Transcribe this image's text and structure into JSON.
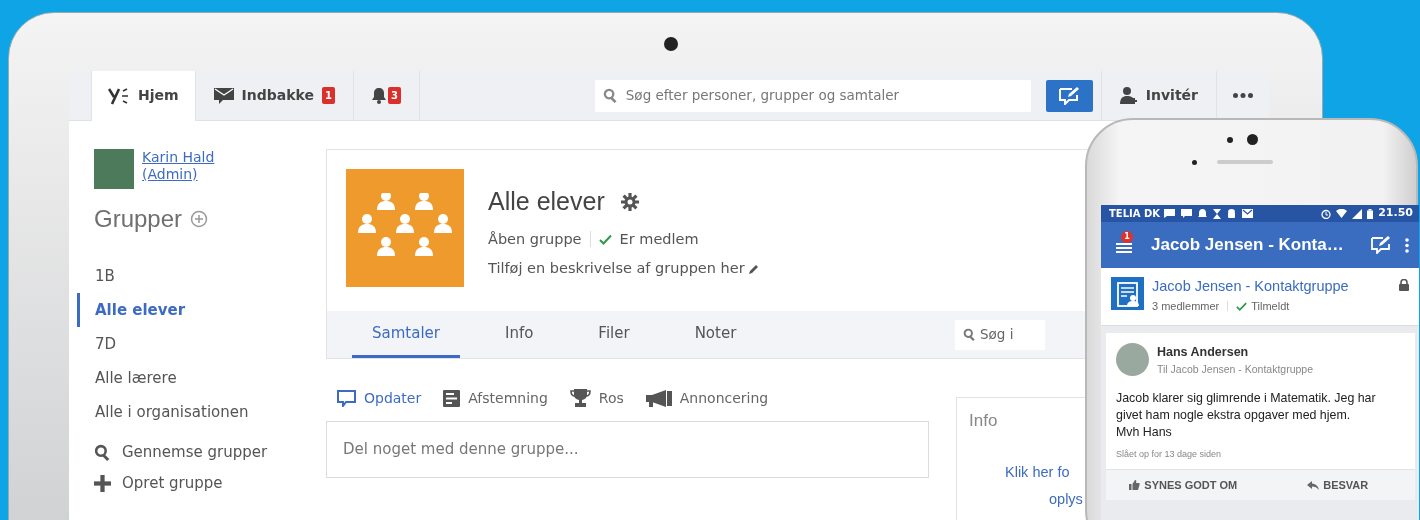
{
  "laptop": {
    "top_bar": {
      "tabs": [
        {
          "kind": "home",
          "label": "Hjem",
          "selected": true
        },
        {
          "kind": "inbox",
          "label": "Indbakke",
          "badge": "1",
          "selected": false
        },
        {
          "kind": "notifications",
          "badge": "3",
          "selected": false
        }
      ],
      "search": {
        "placeholder": "Søg efter personer, grupper og samtaler"
      },
      "invite": "Invitér"
    },
    "sidebar": {
      "user": "Karin Hald (Admin)",
      "groups_heading": "Grupper",
      "groups": [
        {
          "label": "1B",
          "selected": false
        },
        {
          "label": "Alle elever",
          "selected": true
        },
        {
          "label": "7D",
          "selected": false
        },
        {
          "label": "Alle lærere",
          "selected": false
        },
        {
          "label": "Alle i organisationen",
          "selected": false
        }
      ],
      "actions": [
        {
          "kind": "browse",
          "label": "Gennemse grupper"
        },
        {
          "kind": "create",
          "label": "Opret gruppe"
        }
      ]
    },
    "group": {
      "title": "Alle elever",
      "visibility": "Åben gruppe",
      "membership": "Er medlem",
      "description": "Tilføj en beskrivelse af gruppen her",
      "tabs": [
        {
          "label": "Samtaler",
          "selected": true
        },
        {
          "label": "Info",
          "selected": false
        },
        {
          "label": "Filer",
          "selected": false
        },
        {
          "label": "Noter",
          "selected": false
        }
      ],
      "search": {
        "placeholder": "Søg i"
      },
      "composer": {
        "types": [
          {
            "kind": "update",
            "label": "Opdater",
            "selected": true
          },
          {
            "kind": "poll",
            "label": "Afstemning",
            "selected": false
          },
          {
            "kind": "praise",
            "label": "Ros",
            "selected": false
          },
          {
            "kind": "announcement",
            "label": "Annoncering",
            "selected": false
          }
        ],
        "placeholder": "Del noget med denne gruppe..."
      },
      "info": {
        "title": "Info",
        "link_lines": [
          "Klik her fo",
          "oplys"
        ]
      }
    }
  },
  "phone": {
    "status_bar": {
      "carrier": "TELIA DK",
      "time": "21.50"
    },
    "app_bar": {
      "menu_badge": "1",
      "title": "Jacob Jensen - Konta…"
    },
    "group": {
      "name": "Jacob Jensen - Kontaktgruppe",
      "members": "3 medlemmer",
      "status": "Tilmeldt"
    },
    "post": {
      "author": "Hans Andersen",
      "target": "Til Jacob Jensen - Kontaktgruppe",
      "body": "Jacob klarer sig glimrende i Matematik. Jeg har givet ham nogle ekstra opgaver med hjem.\nMvh Hans",
      "time": "Slået op for 13 dage siden",
      "actions": [
        {
          "kind": "like",
          "label": "SYNES GODT OM"
        },
        {
          "kind": "reply",
          "label": "BESVAR"
        }
      ]
    }
  }
}
